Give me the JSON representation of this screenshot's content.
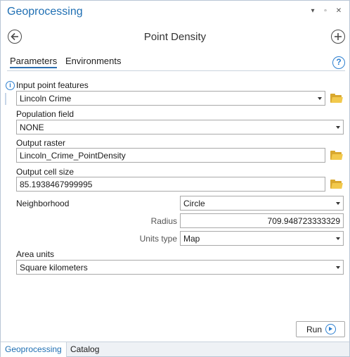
{
  "window": {
    "title": "Geoprocessing",
    "controls": {
      "menu": "▾",
      "maximize": "▫",
      "close": "✕"
    }
  },
  "header": {
    "tool_title": "Point Density",
    "back_icon": "arrow-left-circle-icon",
    "add_icon": "plus-circle-icon"
  },
  "tabs": [
    {
      "label": "Parameters",
      "active": true
    },
    {
      "label": "Environments",
      "active": false
    }
  ],
  "help_icon": "?",
  "info_icon": "i",
  "params": {
    "input_point_features": {
      "label": "Input point features",
      "value": "Lincoln Crime"
    },
    "population_field": {
      "label": "Population field",
      "value": "NONE"
    },
    "output_raster": {
      "label": "Output raster",
      "value": "Lincoln_Crime_PointDensity"
    },
    "output_cell_size": {
      "label": "Output cell size",
      "value": "85.1938467999995"
    },
    "neighborhood": {
      "label": "Neighborhood",
      "value": "Circle"
    },
    "radius": {
      "label": "Radius",
      "value": "709.948723333329"
    },
    "units_type": {
      "label": "Units type",
      "value": "Map"
    },
    "area_units": {
      "label": "Area units",
      "value": "Square kilometers"
    }
  },
  "run_button": {
    "label": "Run"
  },
  "bottom_tabs": [
    {
      "label": "Geoprocessing",
      "active": true
    },
    {
      "label": "Catalog",
      "active": false
    }
  ],
  "colors": {
    "accent": "#1f6fb3",
    "folder": "#f2c94c",
    "border": "#a9a9a9"
  }
}
